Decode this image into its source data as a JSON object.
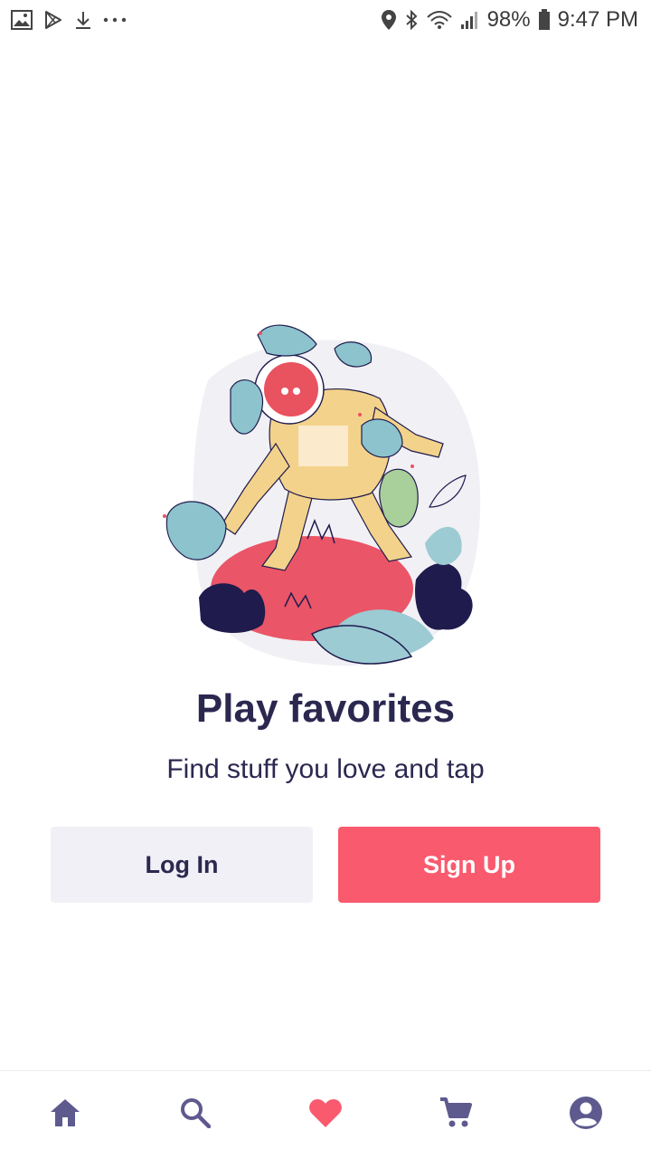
{
  "status_bar": {
    "battery": "98%",
    "time": "9:47 PM",
    "left_icons": [
      "image-icon",
      "play-store-icon",
      "download-icon",
      "more-dots-icon"
    ],
    "right_icons": [
      "location-icon",
      "bluetooth-icon",
      "wifi-icon",
      "signal-icon",
      "battery-icon"
    ]
  },
  "onboarding": {
    "headline": "Play favorites",
    "subtitle": "Find stuff you love and tap",
    "illustration": "astronaut-with-aliens-illustration"
  },
  "buttons": {
    "login": "Log In",
    "signup": "Sign Up"
  },
  "bottom_nav": {
    "items": [
      "home-icon",
      "search-icon",
      "heart-icon",
      "cart-icon",
      "account-icon"
    ],
    "active": "heart-icon"
  },
  "colors": {
    "primary_text": "#2b2850",
    "accent": "#fa5a6e",
    "secondary_button": "#f1f0f6",
    "nav_icon": "#5e5a8e"
  }
}
